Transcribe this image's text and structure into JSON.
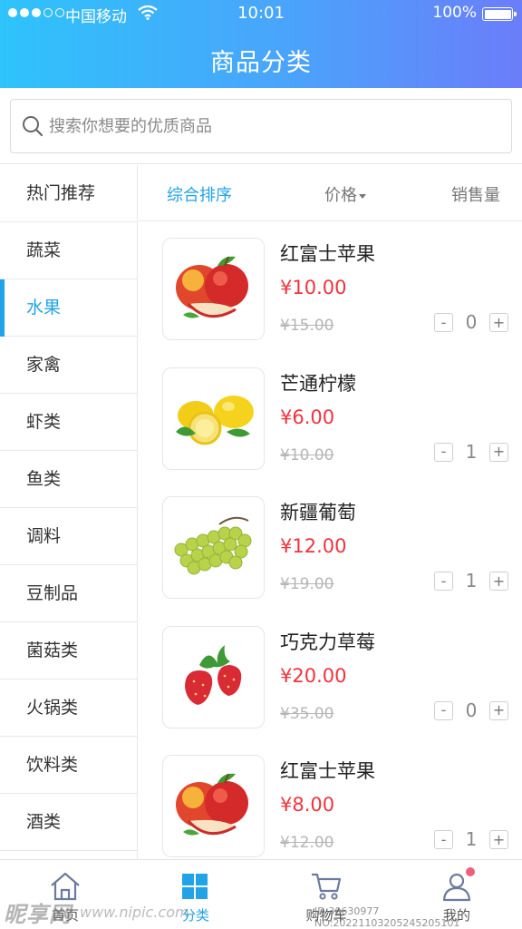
{
  "status_bar": {
    "carrier": "中国移动",
    "time": "10:01",
    "battery": "100%"
  },
  "header": {
    "title": "商品分类"
  },
  "search": {
    "placeholder": "搜索你想要的优质商品"
  },
  "sidebar": {
    "items": [
      {
        "label": "热门推荐",
        "active": false
      },
      {
        "label": "蔬菜",
        "active": false
      },
      {
        "label": "水果",
        "active": true
      },
      {
        "label": "家禽",
        "active": false
      },
      {
        "label": "虾类",
        "active": false
      },
      {
        "label": "鱼类",
        "active": false
      },
      {
        "label": "调料",
        "active": false
      },
      {
        "label": "豆制品",
        "active": false
      },
      {
        "label": "菌菇类",
        "active": false
      },
      {
        "label": "火锅类",
        "active": false
      },
      {
        "label": "饮料类",
        "active": false
      },
      {
        "label": "酒类",
        "active": false
      }
    ]
  },
  "sort": {
    "comprehensive": "综合排序",
    "price": "价格",
    "sales": "销售量"
  },
  "products": [
    {
      "name": "红富士苹果",
      "price": "¥10.00",
      "old_price": "¥15.00",
      "qty": "0",
      "image": "apple"
    },
    {
      "name": "芒通柠檬",
      "price": "¥6.00",
      "old_price": "¥10.00",
      "qty": "1",
      "image": "lemon"
    },
    {
      "name": "新疆葡萄",
      "price": "¥12.00",
      "old_price": "¥19.00",
      "qty": "1",
      "image": "grape"
    },
    {
      "name": "巧克力草莓",
      "price": "¥20.00",
      "old_price": "¥35.00",
      "qty": "0",
      "image": "strawberry"
    },
    {
      "name": "红富士苹果",
      "price": "¥8.00",
      "old_price": "¥12.00",
      "qty": "1",
      "image": "apple"
    }
  ],
  "stepper": {
    "minus": "-",
    "plus": "+"
  },
  "tabbar": {
    "home": "首页",
    "category": "分类",
    "cart": "购物车",
    "mine": "我的"
  },
  "watermark": {
    "logo": "昵享网",
    "url": "www.nipic.com",
    "id": "ID:30630977 NO:20221103205245205101"
  },
  "colors": {
    "accent": "#21a3e8",
    "price_red": "#f0333d",
    "header_gradient": [
      "#2ec3fb",
      "#6b7dfa"
    ]
  }
}
